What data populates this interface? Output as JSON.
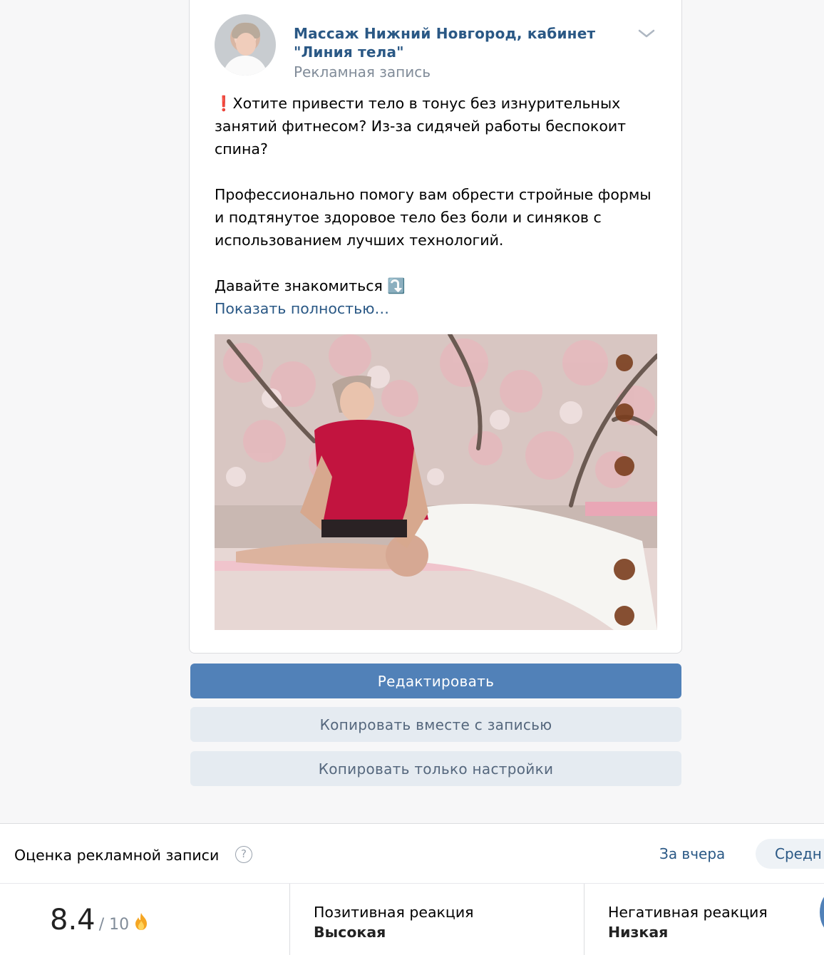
{
  "post": {
    "author": "Массаж Нижний Новгород, кабинет \"Линия тела\"",
    "type_label": "Рекламная запись",
    "text": "❗️Хотите привести тело в тонус без изнурительных занятий фитнесом? Из-за сидячей работы беспокоит спина?\n\nПрофессионально помогу вам обрести стройные формы и подтянутое здоровое тело без боли и синяков с использованием лучших технологий.\n\nДавайте знакомиться ⤵️",
    "show_more": "Показать полностью…"
  },
  "actions": {
    "edit": "Редактировать",
    "copy_with_post": "Копировать вместе с записью",
    "copy_settings_only": "Копировать только настройки"
  },
  "rating": {
    "title": "Оценка рекламной записи",
    "help": "?",
    "period_yesterday": "За вчера",
    "period_average": "Средн",
    "score": "8.4",
    "score_max": "/ 10",
    "positive_label": "Позитивная реакция",
    "positive_value": "Высокая",
    "negative_label": "Негативная реакция",
    "negative_value": "Низкая"
  },
  "colors": {
    "link": "#2a5885",
    "primary_button": "#5181b8",
    "secondary_button": "#e5ebf1"
  }
}
